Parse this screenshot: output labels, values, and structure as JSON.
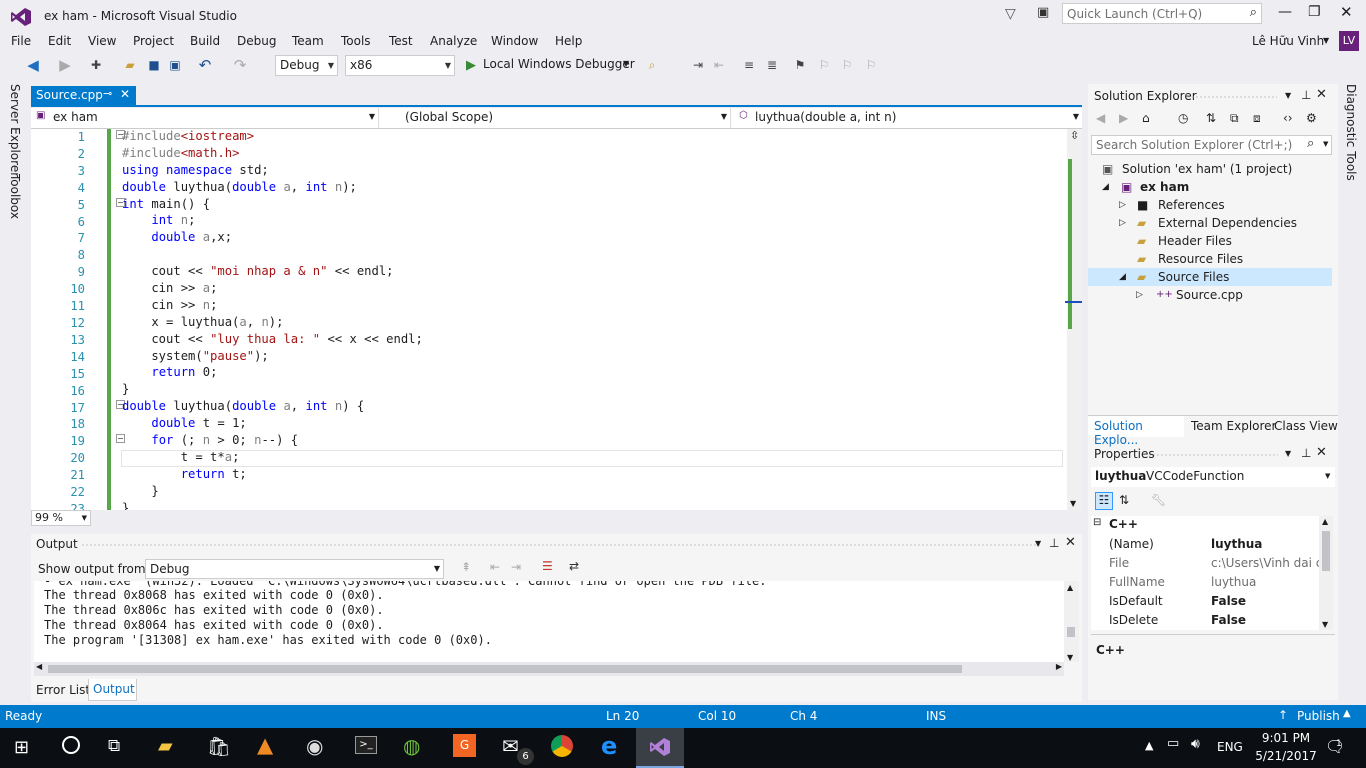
{
  "title": {
    "window_title": "ex ham - Microsoft Visual Studio",
    "quick_launch_placeholder": "Quick Launch (Ctrl+Q)"
  },
  "menu": [
    "File",
    "Edit",
    "View",
    "Project",
    "Build",
    "Debug",
    "Team",
    "Tools",
    "Test",
    "Analyze",
    "Window",
    "Help"
  ],
  "user": {
    "name": "Lê Hữu Vinh",
    "initials": "LV"
  },
  "toolbar": {
    "config": "Debug",
    "platform": "x86",
    "debugger": "Local Windows Debugger"
  },
  "side_tabs": {
    "server_explorer": "Server Explorer",
    "toolbox": "Toolbox",
    "diagnostic": "Diagnostic Tools"
  },
  "editor": {
    "tab_label": "Source.cpp",
    "nav_project": "ex ham",
    "nav_scope": "(Global Scope)",
    "nav_member": "luythua(double a, int n)",
    "zoom": "99 %",
    "line_numbers": [
      "1",
      "2",
      "3",
      "4",
      "5",
      "6",
      "7",
      "8",
      "9",
      "10",
      "11",
      "12",
      "13",
      "14",
      "15",
      "16",
      "17",
      "18",
      "19",
      "20",
      "21",
      "22",
      "23"
    ],
    "lines": [
      "#include<iostream>",
      "#include<math.h>",
      "using namespace std;",
      "double luythua(double a, int n);",
      "int main() {",
      "    int n;",
      "    double a,x;",
      "",
      "    cout << \"moi nhap a & n\" << endl;",
      "    cin >> a;",
      "    cin >> n;",
      "    x = luythua(a, n);",
      "    cout << \"luy thua la: \" << x << endl;",
      "    system(\"pause\");",
      "    return 0;",
      "}",
      "double luythua(double a, int n) {",
      "    double t = 1;",
      "    for (; n > 0; n--) {",
      "        t = t*a;",
      "        return t;",
      "    }",
      "}"
    ]
  },
  "output": {
    "title": "Output",
    "show_from_label": "Show output from:",
    "source": "Debug",
    "lines": [
      "The thread 0x8068 has exited with code 0 (0x0).",
      "The thread 0x806c has exited with code 0 (0x0).",
      "The thread 0x8064 has exited with code 0 (0x0).",
      "The program '[31308] ex ham.exe' has exited with code 0 (0x0)."
    ],
    "tabs": [
      "Error List",
      "Output"
    ]
  },
  "solution_explorer": {
    "title": "Solution Explorer",
    "search_placeholder": "Search Solution Explorer (Ctrl+;)",
    "items": [
      "Solution 'ex ham' (1 project)",
      "ex ham",
      "References",
      "External Dependencies",
      "Header Files",
      "Resource Files",
      "Source Files",
      "Source.cpp"
    ],
    "tabs": [
      "Solution Explo...",
      "Team Explorer",
      "Class View"
    ]
  },
  "properties": {
    "title": "Properties",
    "object_name": "luythua",
    "object_type": "VCCodeFunction",
    "category": "C++",
    "rows": [
      {
        "name": "(Name)",
        "value": "luythua"
      },
      {
        "name": "File",
        "value": "c:\\Users\\Vinh dai ca"
      },
      {
        "name": "FullName",
        "value": "luythua"
      },
      {
        "name": "IsDefault",
        "value": "False"
      },
      {
        "name": "IsDelete",
        "value": "False"
      }
    ],
    "description": "C++"
  },
  "status": {
    "state": "Ready",
    "ln": "Ln 20",
    "col": "Col 10",
    "ch": "Ch 4",
    "mode": "INS",
    "publish": "Publish"
  },
  "taskbar": {
    "lang": "ENG",
    "time": "9:01 PM",
    "date": "5/21/2017",
    "badge": "6",
    "notifications": "1"
  },
  "colors": {
    "accent": "#007acc",
    "vs_purple": "#68217a",
    "keyword": "#0000ff",
    "string": "#a31515"
  }
}
